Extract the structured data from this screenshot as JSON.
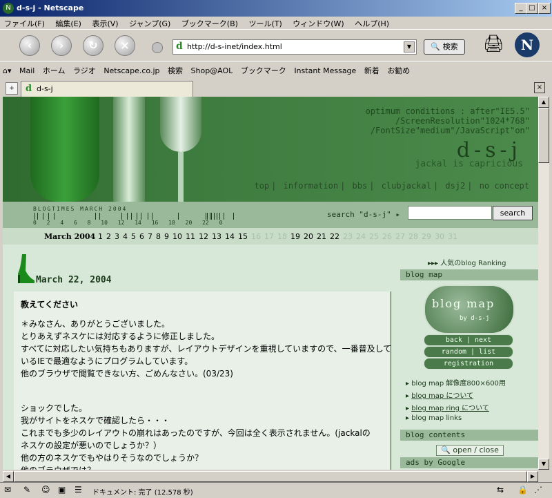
{
  "window": {
    "title": "d-s-j - Netscape"
  },
  "menu": [
    "ファイル(F)",
    "編集(E)",
    "表示(V)",
    "ジャンプ(G)",
    "ブックマーク(B)",
    "ツール(T)",
    "ウィンドウ(W)",
    "ヘルプ(H)"
  ],
  "nav": {
    "url": "http://d-s-inet/index.html",
    "search_label": "検索"
  },
  "personal_toolbar": [
    "Mail",
    "ホーム",
    "ラジオ",
    "Netscape.co.jp",
    "検索",
    "Shop@AOL",
    "ブックマーク",
    "Instant Message",
    "新着",
    "お勧め"
  ],
  "tab": {
    "label": "d-s-j"
  },
  "page": {
    "conditions": [
      "optimum conditions : after\"IE5.5\"",
      "/ScreenResolution\"1024*768\"",
      "/FontSize\"medium\"/JavaScript\"on\""
    ],
    "logo": "d-s-j",
    "tagline": "jackal is capricious",
    "nav_links": [
      "top",
      "information",
      "bbs",
      "clubjackal",
      "dsj2",
      "no concept"
    ],
    "blogtimes_label": "BLOGTIMES  MARCH 2004",
    "blogtimes_hours": [
      "0",
      "2",
      "4",
      "6",
      "8",
      "10",
      "12",
      "14",
      "16",
      "18",
      "20",
      "22",
      "0"
    ],
    "search_label": "search \"d-s-j\" ▸",
    "search_button": "search",
    "calendar": {
      "month": "March 2004",
      "days": [
        {
          "d": "1",
          "on": true
        },
        {
          "d": "2",
          "on": true
        },
        {
          "d": "3",
          "on": true
        },
        {
          "d": "4",
          "on": true
        },
        {
          "d": "5",
          "on": true
        },
        {
          "d": "6",
          "on": true
        },
        {
          "d": "7",
          "on": true
        },
        {
          "d": "8",
          "on": true
        },
        {
          "d": "9",
          "on": true
        },
        {
          "d": "10",
          "on": true
        },
        {
          "d": "11",
          "on": true
        },
        {
          "d": "12",
          "on": true
        },
        {
          "d": "13",
          "on": true
        },
        {
          "d": "14",
          "on": true
        },
        {
          "d": "15",
          "on": true
        },
        {
          "d": "16",
          "on": false
        },
        {
          "d": "17",
          "on": false
        },
        {
          "d": "18",
          "on": false
        },
        {
          "d": "19",
          "on": true
        },
        {
          "d": "20",
          "on": true
        },
        {
          "d": "21",
          "on": true
        },
        {
          "d": "22",
          "on": true
        },
        {
          "d": "23",
          "on": false
        },
        {
          "d": "24",
          "on": false
        },
        {
          "d": "25",
          "on": false
        },
        {
          "d": "26",
          "on": false
        },
        {
          "d": "27",
          "on": false
        },
        {
          "d": "28",
          "on": false
        },
        {
          "d": "29",
          "on": false
        },
        {
          "d": "30",
          "on": false
        },
        {
          "d": "31",
          "on": false
        }
      ]
    },
    "date": "March 22, 2004",
    "post": {
      "title": "教えてください",
      "lines": [
        "＊みなさん、ありがとうございました。",
        "とりあえずネスケには対応するように修正しました。",
        "すべてに対応したい気持ちもありますが、レイアウトデザインを重視していますので、一番普及して",
        "いるIEで最適なようにプログラムしています。",
        "他のブラウザで閲覧できない方、ごめんなさい。(03/23)",
        "",
        "",
        "ショックでした。",
        "我がサイトをネスケで確認したら・・・",
        "これまでも多少のレイアウトの崩れはあったのですが、今回は全く表示されません。(jackalの",
        "ネスケの設定が悪いのでしょうか？）",
        "他の方のネスケでもやはりそうなのでしょうか？",
        "他のブラウザでは？"
      ]
    },
    "sidebar": {
      "ranking": "▸▸▸ 人気のblog Ranking",
      "blog_map_head": "blog map",
      "blog_map_title": "blog map",
      "blog_map_sub": "by d-s-j",
      "pills": [
        "back | next",
        "random | list",
        "registration"
      ],
      "items": [
        "blog map 解像度800×600用",
        "blog map について",
        "blog map ring について",
        "blog map links"
      ],
      "contents_head": "blog contents",
      "open_close": "open / close",
      "ads_head": "ads by Google"
    }
  },
  "status": {
    "text": "ドキュメント: 完了 (12.578 秒)"
  }
}
